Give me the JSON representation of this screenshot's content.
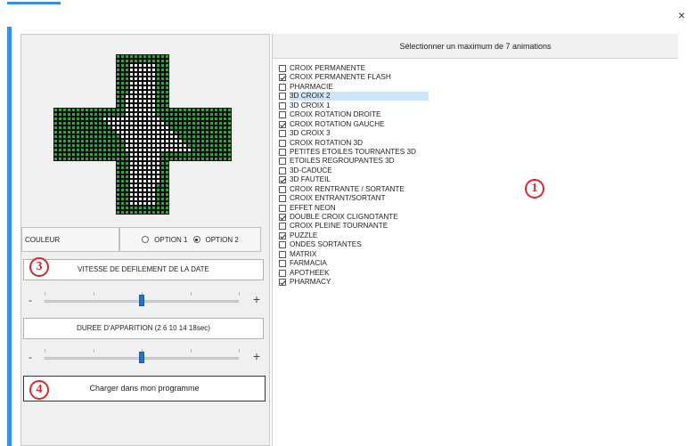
{
  "window": {
    "close_glyph": "×",
    "close_icon": "close-icon"
  },
  "header": {
    "title": "Sélectionner un maximum de 7 animations"
  },
  "couleur": {
    "label": "COULEUR",
    "option1": "OPTION 1",
    "option2": "OPTION 2",
    "selected": "OPTION 2"
  },
  "speed": {
    "label": "VITESSE DE DEFILEMENT DE LA DATE",
    "minus": "-",
    "plus": "+",
    "value_fraction": 0.5
  },
  "duration": {
    "label": "DUREE D'APPARITION (2 6 10 14 18sec)",
    "minus": "-",
    "plus": "+",
    "value_fraction": 0.5
  },
  "load_button": "Charger dans mon programme",
  "badges": {
    "b1": "1",
    "b3": "3",
    "b4": "4"
  },
  "colors": {
    "led_green": "#2aa63b",
    "led_white": "#f2f2f2",
    "led_bg": "#0d0d0d",
    "accent": "#3a8de0",
    "badge_red": "#d42a2a"
  },
  "animations": [
    {
      "label": "CROIX PERMANENTE",
      "checked": false
    },
    {
      "label": "CROIX PERMANENTE FLASH",
      "checked": true
    },
    {
      "label": "PHARMACIE",
      "checked": false
    },
    {
      "label": "3D CROIX 2",
      "checked": false,
      "selected": true
    },
    {
      "label": "3D CROIX 1",
      "checked": false
    },
    {
      "label": "CROIX ROTATION DROITE",
      "checked": false
    },
    {
      "label": "CROIX ROTATION GAUCHE",
      "checked": true
    },
    {
      "label": "3D CROIX 3",
      "checked": false
    },
    {
      "label": "CROIX ROTATION 3D",
      "checked": false
    },
    {
      "label": "PETITES ETOILES TOURNANTES 3D",
      "checked": false
    },
    {
      "label": "ETOILES REGROUPANTES 3D",
      "checked": false
    },
    {
      "label": "3D-CADUCE",
      "checked": false
    },
    {
      "label": "3D FAUTEIL",
      "checked": true
    },
    {
      "label": "CROIX RENTRANTE / SORTANTE",
      "checked": false
    },
    {
      "label": "CROIX ENTRANT/SORTANT",
      "checked": false
    },
    {
      "label": "EFFET NEON",
      "checked": false
    },
    {
      "label": "DOUBLE CROIX CLIGNOTANTE",
      "checked": true
    },
    {
      "label": "CROIX PLEINE TOURNANTE",
      "checked": false
    },
    {
      "label": "PUZZLE",
      "checked": true
    },
    {
      "label": "ONDES SORTANTES",
      "checked": false
    },
    {
      "label": "MATRIX",
      "checked": false
    },
    {
      "label": "FARMACIA",
      "checked": false
    },
    {
      "label": "APOTHEEK",
      "checked": false
    },
    {
      "label": "PHARMACY",
      "checked": true
    }
  ]
}
